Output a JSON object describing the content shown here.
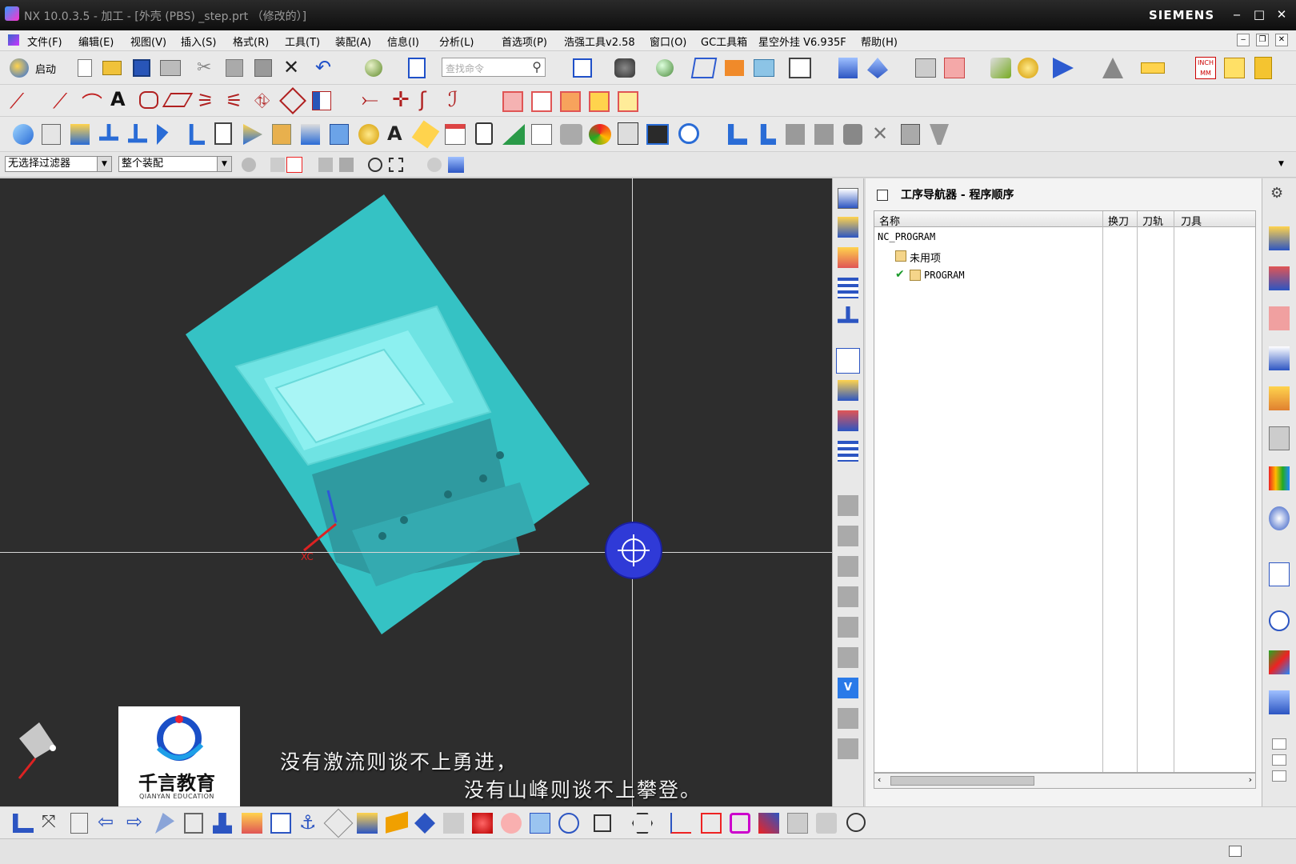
{
  "window": {
    "title": "NX 10.0.3.5 - 加工 - [外壳 (PBS) _step.prt （修改的）]",
    "brand": "SIEMENS",
    "controls": [
      "‒",
      "□",
      "✕"
    ]
  },
  "menu": {
    "items": [
      "文件(F)",
      "编辑(E)",
      "视图(V)",
      "插入(S)",
      "格式(R)",
      "工具(T)",
      "装配(A)",
      "信息(I)",
      "分析(L)",
      "首选项(P)",
      "浩强工具v2.58",
      "窗口(O)",
      "GC工具箱",
      "星空外挂 V6.935F",
      "帮助(H)"
    ]
  },
  "toolbar": {
    "start_label": "启动",
    "search_placeholder": "查找命令"
  },
  "filters": {
    "selection_filter": "无选择过滤器",
    "scope": "整个装配"
  },
  "viewport": {
    "axis_label": "XC",
    "watermark_brand": "千言教育",
    "watermark_sub": "QIANYAN EDUCATION",
    "subtitle_line1": "没有激流则谈不上勇进，",
    "subtitle_line2": "没有山峰则谈不上攀登。",
    "colors": {
      "background": "#2d2d2d",
      "part": "#2ec4c4",
      "dynamic_handle": "#2f3ad7"
    }
  },
  "navigator": {
    "title": "工序导航器 - 程序顺序",
    "columns": [
      "名称",
      "换刀",
      "刀轨",
      "刀具"
    ],
    "rows": [
      {
        "name": "NC_PROGRAM"
      },
      {
        "name": "未用项"
      },
      {
        "name": "PROGRAM"
      }
    ]
  }
}
